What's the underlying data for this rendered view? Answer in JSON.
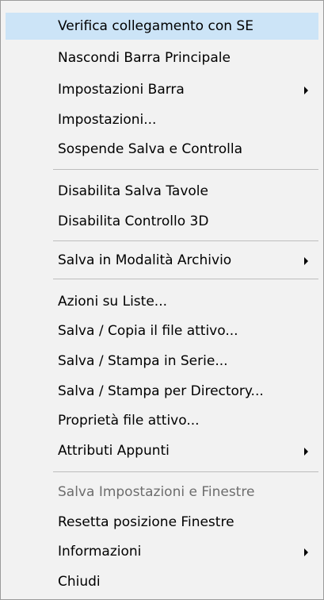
{
  "menu": {
    "items": [
      {
        "label": "Verifica collegamento con SE"
      },
      {
        "label": "Nascondi Barra Principale"
      },
      {
        "label": "Impostazioni Barra",
        "submenu": true
      },
      {
        "label": "Impostazioni..."
      },
      {
        "label": "Sospende Salva e Controlla"
      },
      {
        "label": "Disabilita Salva Tavole"
      },
      {
        "label": "Disabilita Controllo 3D"
      },
      {
        "label": "Salva in Modalità Archivio",
        "submenu": true
      },
      {
        "label": "Azioni su Liste..."
      },
      {
        "label": "Salva / Copia il file attivo..."
      },
      {
        "label": "Salva / Stampa in Serie..."
      },
      {
        "label": "Salva / Stampa per Directory..."
      },
      {
        "label": "Proprietà file attivo..."
      },
      {
        "label": "Attributi Appunti",
        "submenu": true
      },
      {
        "label": "Salva Impostazioni e Finestre",
        "disabled": true
      },
      {
        "label": "Resetta posizione Finestre"
      },
      {
        "label": "Informazioni",
        "submenu": true
      },
      {
        "label": "Chiudi"
      }
    ],
    "highlighted_item": "Verifica collegamento con SE",
    "colors": {
      "background": "#f2f2f2",
      "highlight": "#cce4f7",
      "border": "#9b9b9b",
      "separator": "#bdbdbd",
      "disabled_text": "#6d6d6d"
    }
  }
}
